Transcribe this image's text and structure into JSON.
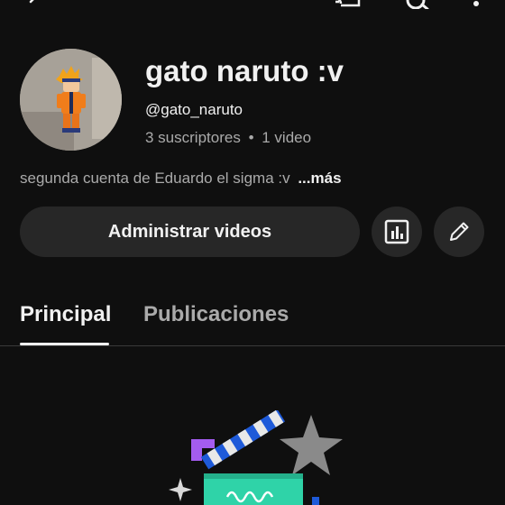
{
  "channel": {
    "name": "gato naruto :v",
    "handle": "@gato_naruto",
    "subscribers": "3 suscriptores",
    "separator": "•",
    "videos": "1 video",
    "description": "segunda cuenta de Eduardo el sigma :v",
    "more_label": "...más"
  },
  "actions": {
    "manage_videos_label": "Administrar videos",
    "analytics_icon": "analytics-icon",
    "edit_icon": "pencil-icon"
  },
  "tabs": [
    {
      "label": "Principal",
      "active": true
    },
    {
      "label": "Publicaciones",
      "active": false
    }
  ],
  "topbar": {
    "icons": [
      "back-arrow-icon",
      "cast-icon",
      "search-icon",
      "more-icon"
    ]
  },
  "colors": {
    "background": "#0f0f0f",
    "surface": "#272727",
    "text_primary": "#f1f1f1",
    "text_secondary": "#aaaaaa"
  }
}
